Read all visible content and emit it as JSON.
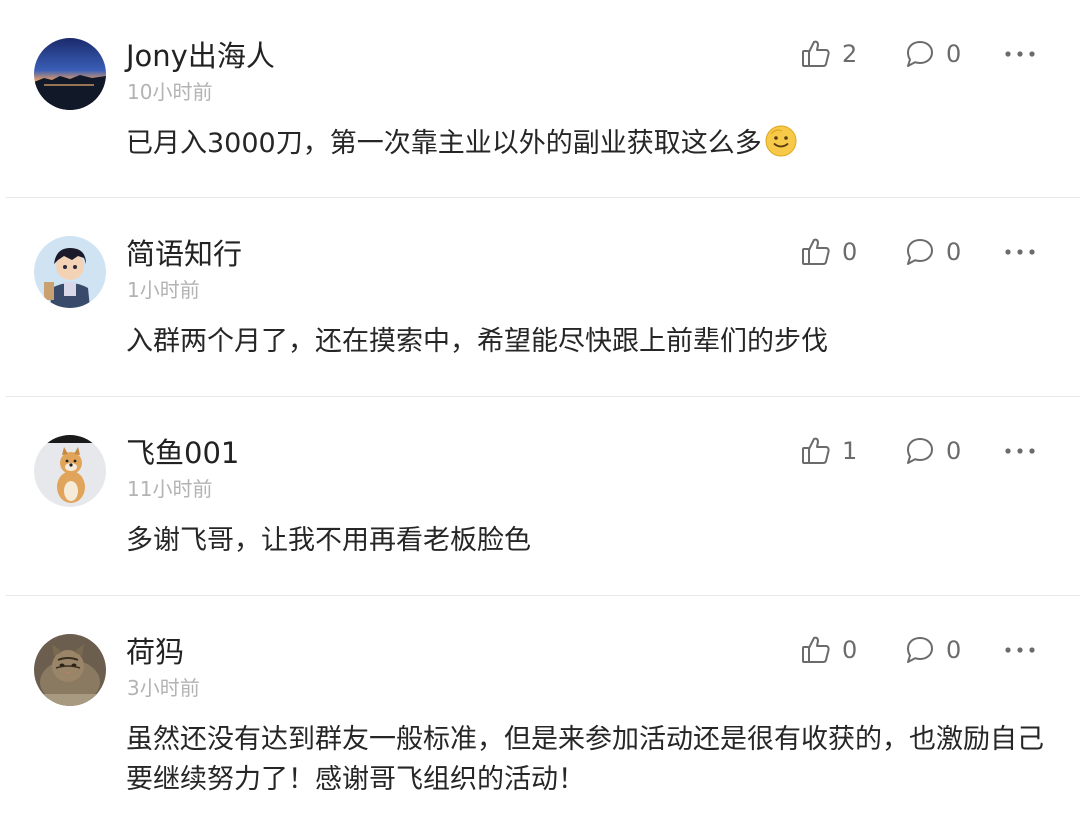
{
  "comments": [
    {
      "username": "Jony出海人",
      "time": "10小时前",
      "text": "已月入3000刀，第一次靠主业以外的副业获取这么多",
      "likes": "2",
      "replies": "0",
      "emoji": "smiling-face"
    },
    {
      "username": "简语知行",
      "time": "1小时前",
      "text": "入群两个月了，还在摸索中，希望能尽快跟上前辈们的步伐",
      "likes": "0",
      "replies": "0"
    },
    {
      "username": "飞鱼001",
      "time": "11小时前",
      "text": "多谢飞哥，让我不用再看老板脸色",
      "likes": "1",
      "replies": "0"
    },
    {
      "username": "荷犸",
      "time": "3小时前",
      "text": "虽然还没有达到群友一般标准，但是来参加活动还是很有收获的，也激励自己要继续努力了！感谢哥飞组织的活动！",
      "likes": "0",
      "replies": "0"
    }
  ],
  "icons": {
    "like": "thumbs-up-icon",
    "reply": "comment-bubble-icon",
    "more": "more-dots-icon"
  },
  "colors": {
    "icon": "#6b6b6b",
    "timestamp": "#b3b3b3",
    "divider": "#e8e8e8"
  }
}
